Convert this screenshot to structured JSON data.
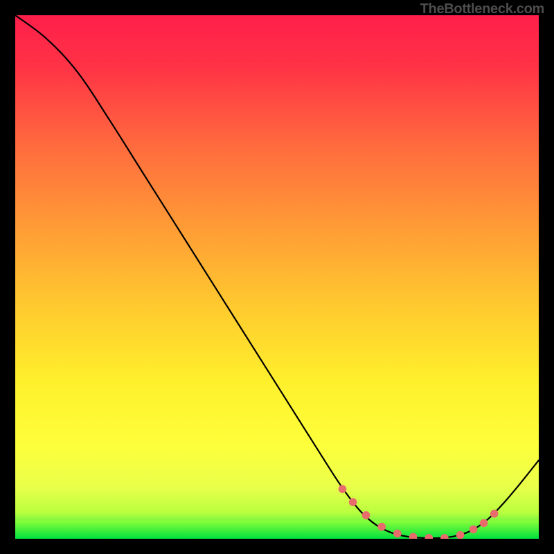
{
  "attribution": "TheBottleneck.com",
  "chart_data": {
    "type": "line",
    "title": "",
    "xlabel": "",
    "ylabel": "",
    "xlim": [
      0,
      100
    ],
    "ylim": [
      0,
      100
    ],
    "grid": false,
    "series": [
      {
        "name": "curve",
        "x": [
          0,
          6,
          12,
          18,
          24,
          30,
          36,
          42,
          48,
          54,
          60,
          63,
          66,
          69,
          72,
          75,
          78,
          81,
          84,
          87,
          90,
          93,
          96,
          100
        ],
        "y": [
          100,
          95.5,
          89,
          80,
          70.5,
          61,
          51.5,
          42,
          32.5,
          23,
          13.5,
          9,
          5.2,
          2.6,
          1.1,
          0.4,
          0.15,
          0.15,
          0.5,
          1.5,
          3.5,
          6.5,
          10,
          15
        ]
      }
    ],
    "markers": {
      "name": "highlight-dots",
      "color": "#e86c6c",
      "x": [
        62.5,
        64.5,
        67,
        70,
        73,
        76,
        79,
        82,
        85,
        87.5,
        89.5,
        91.5
      ],
      "y": [
        9.5,
        7,
        4.5,
        2.3,
        1.0,
        0.35,
        0.15,
        0.15,
        0.7,
        1.8,
        3.0,
        4.8
      ]
    },
    "green_band": {
      "type": "area",
      "y_from": 0,
      "y_to": 3.5,
      "color_top": "#6cff2e",
      "color_bottom": "#00e23e"
    }
  }
}
